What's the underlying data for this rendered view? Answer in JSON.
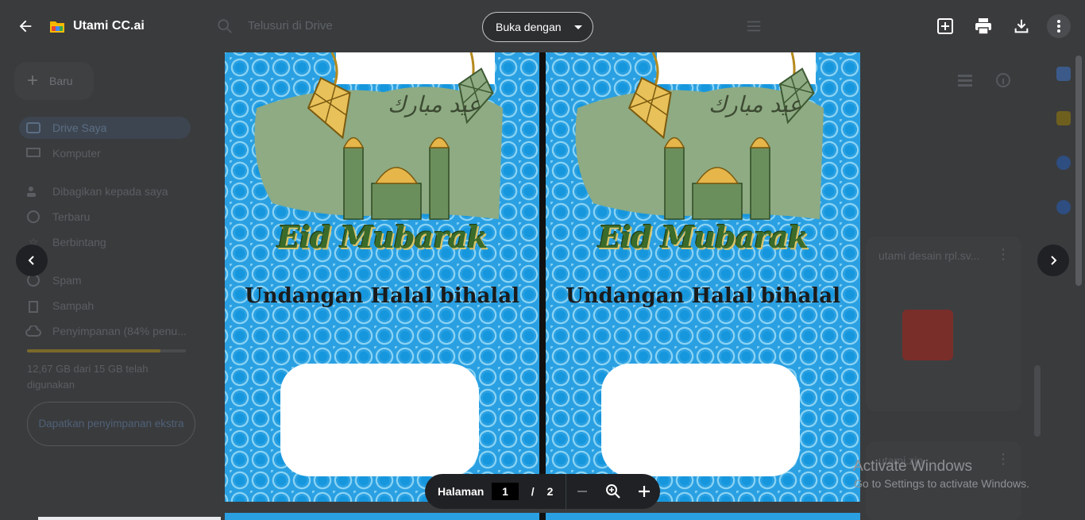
{
  "viewer": {
    "title": "Utami CC.ai",
    "open_with_label": "Buka dengan"
  },
  "drive_background": {
    "search_placeholder": "Telusuri di Drive",
    "new_button": "Baru",
    "sidebar": [
      {
        "label": "Drive Saya"
      },
      {
        "label": "Komputer"
      },
      {
        "label": "Dibagikan kepada saya"
      },
      {
        "label": "Terbaru"
      },
      {
        "label": "Berbintang"
      },
      {
        "label": "Spam"
      },
      {
        "label": "Sampah"
      },
      {
        "label": "Penyimpanan (84% penu..."
      }
    ],
    "storage_percent": 0.84,
    "storage_text": "12,67 GB dari 15 GB telah digunakan",
    "get_storage_button": "Dapatkan penyimpanan ekstra",
    "files": [
      {
        "name": "utami desain rpl.sv..."
      },
      {
        "name": "utami.zip"
      }
    ]
  },
  "document": {
    "pages": [
      {
        "eid_text": "Eid Mubarak",
        "invite_text": "Undangan Halal bihalal"
      },
      {
        "eid_text": "Eid Mubarak",
        "invite_text": "Undangan Halal bihalal"
      }
    ]
  },
  "page_controls": {
    "label": "Halaman",
    "current": "1",
    "separator": "/",
    "total": "2"
  },
  "watermark": {
    "line1": "Activate Windows",
    "line2": "Go to Settings to activate Windows."
  },
  "colors": {
    "page_blue": "#2aa0e2",
    "eid_green": "#3a6b2a",
    "overlay_bg": "#3a3b3d"
  }
}
